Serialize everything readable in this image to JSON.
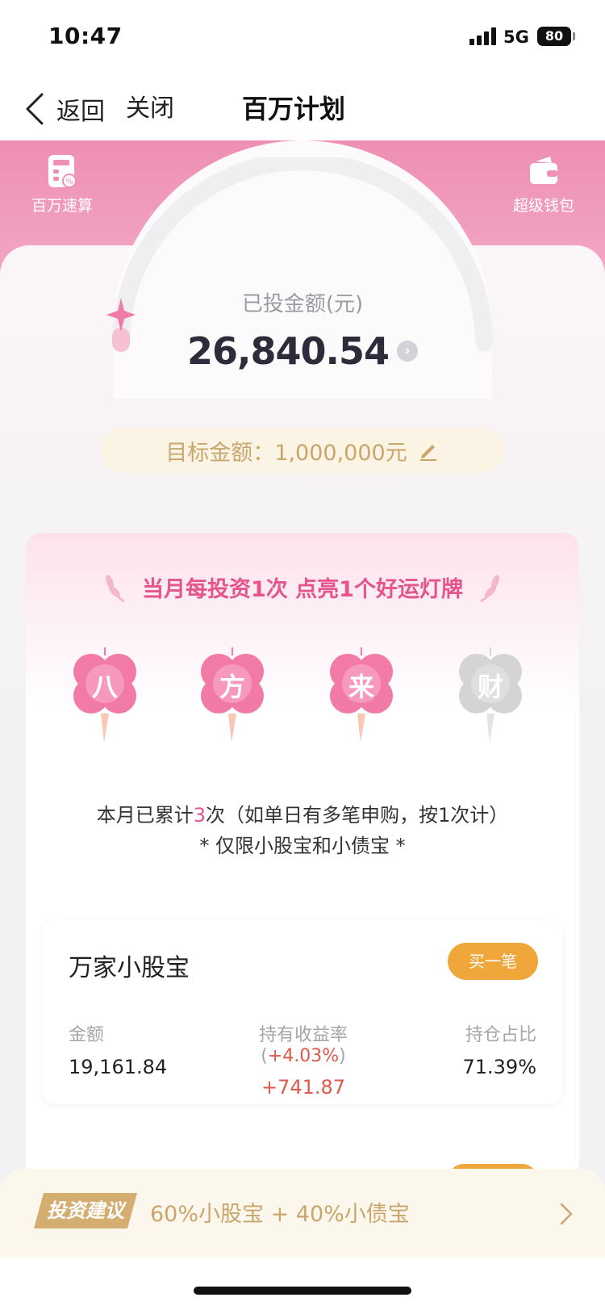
{
  "status_bar": {
    "time": "10:47",
    "network": "5G",
    "battery": "80"
  },
  "nav": {
    "back_label": "返回",
    "close_label": "关闭",
    "title": "百万计划"
  },
  "header": {
    "left_tool": {
      "label": "百万速算",
      "icon": "calculator-icon"
    },
    "right_tool": {
      "label": "超级钱包",
      "icon": "wallet-icon"
    }
  },
  "summary": {
    "invested_label": "已投金额(元)",
    "invested_value": "26,840.54",
    "progress_fraction": 0.027,
    "target_text": "目标金额：1,000,000元"
  },
  "lucky": {
    "banner": "当月每投资1次 点亮1个好运灯牌",
    "clovers": [
      {
        "char": "八",
        "lit": true
      },
      {
        "char": "方",
        "lit": true
      },
      {
        "char": "来",
        "lit": true
      },
      {
        "char": "财",
        "lit": false
      }
    ],
    "count_prefix": "本月已累计",
    "count_value": "3",
    "count_suffix": "次（如单日有多笔申购，按1次计）",
    "limit_note": "* 仅限小股宝和小债宝 *"
  },
  "fund": {
    "name": "万家小股宝",
    "buy_label": "买一笔",
    "amount_label": "金额",
    "amount_value": "19,161.84",
    "return_label": "持有收益率(",
    "return_rate": "+4.03%",
    "return_label_close": ")",
    "return_value": "+741.87",
    "share_label": "持仓占比",
    "share_value": "71.39%"
  },
  "advice": {
    "tag": "投资建议",
    "text": "60%小股宝 + 40%小债宝"
  },
  "colors": {
    "pink": "#ee8fb3",
    "accent_pink": "#e6548d",
    "gold": "#c9a66c",
    "orange": "#efa63a",
    "gain_red": "#e0584a"
  }
}
